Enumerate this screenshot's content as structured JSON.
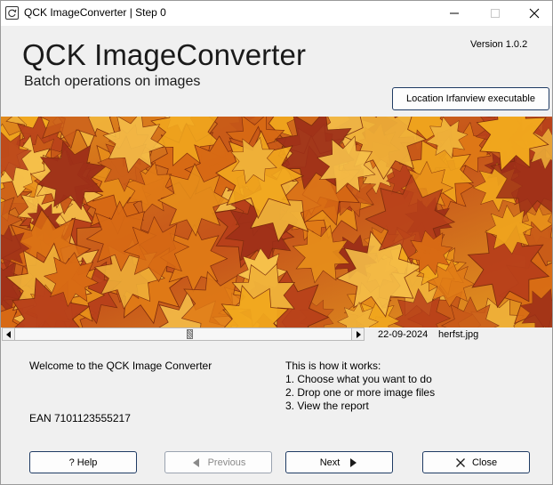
{
  "window": {
    "title": "QCK ImageConverter | Step 0"
  },
  "header": {
    "app_title": "QCK ImageConverter",
    "subtitle": "Batch operations on images",
    "version": "Version 1.0.2",
    "location_button": "Location Irfanview executable"
  },
  "image_info": {
    "date": "22-09-2024",
    "filename": "herfst.jpg"
  },
  "body": {
    "welcome": "Welcome to the QCK Image Converter",
    "ean": "EAN 7101123555217",
    "how_title": "This is how it works:",
    "steps": [
      "1. Choose what you want to do",
      "2. Drop one or more image files",
      "3. View the report"
    ]
  },
  "buttons": {
    "help": "? Help",
    "previous": "Previous",
    "next": "Next",
    "close": "Close"
  },
  "icons": {
    "app": "refresh-icon",
    "minimize": "minimize-icon",
    "maximize": "maximize-icon",
    "close": "close-icon",
    "previous": "triangle-left-icon",
    "next": "triangle-right-icon",
    "close_button": "x-icon"
  }
}
